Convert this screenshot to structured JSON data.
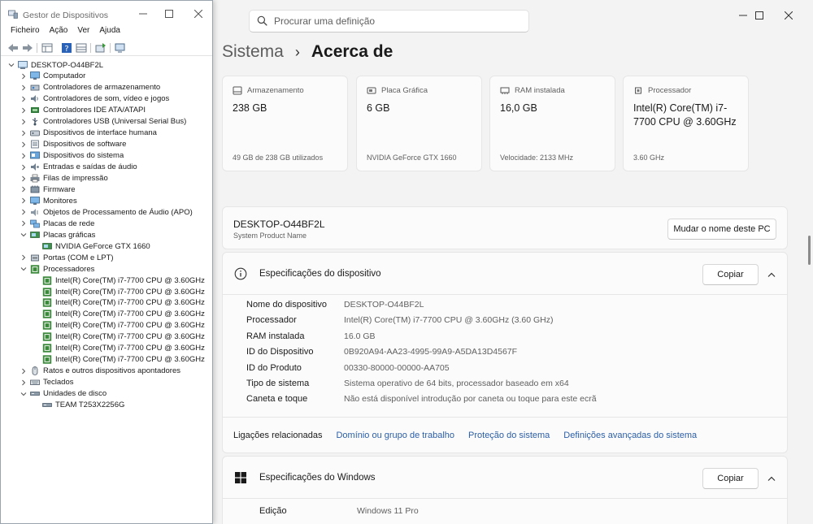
{
  "settings": {
    "search_placeholder": "Procurar uma definição",
    "breadcrumb_parent": "Sistema",
    "breadcrumb_current": "Acerca de",
    "cards": [
      {
        "label": "Armazenamento",
        "value": "238 GB",
        "sub": "49 GB de 238 GB utilizados",
        "icon": "storage-icon"
      },
      {
        "label": "Placa Gráfica",
        "value": "6 GB",
        "sub": "NVIDIA GeForce GTX 1660",
        "icon": "gpu-icon"
      },
      {
        "label": "RAM instalada",
        "value": "16,0 GB",
        "sub": "Velocidade: 2133 MHz",
        "icon": "ram-icon"
      },
      {
        "label": "Processador",
        "value": "Intel(R) Core(TM) i7-7700 CPU @ 3.60GHz",
        "sub": "3.60 GHz",
        "icon": "cpu-icon"
      }
    ],
    "device_name": "DESKTOP-O44BF2L",
    "device_sub": "System Product Name",
    "rename_button": "Mudar o nome deste PC",
    "device_specs_title": "Especificações do dispositivo",
    "copy_button": "Copiar",
    "device_specs": [
      {
        "k": "Nome do dispositivo",
        "v": "DESKTOP-O44BF2L"
      },
      {
        "k": "Processador",
        "v": "Intel(R) Core(TM) i7-7700 CPU @ 3.60GHz (3.60 GHz)"
      },
      {
        "k": "RAM instalada",
        "v": "16.0 GB"
      },
      {
        "k": "ID do Dispositivo",
        "v": "0B920A94-AA23-4995-99A9-A5DA13D4567F"
      },
      {
        "k": "ID do Produto",
        "v": "00330-80000-00000-AA705"
      },
      {
        "k": "Tipo de sistema",
        "v": "Sistema operativo de 64 bits, processador baseado em x64"
      },
      {
        "k": "Caneta e toque",
        "v": "Não está disponível introdução por caneta ou toque para este ecrã"
      }
    ],
    "related_label": "Ligações relacionadas",
    "related_links": [
      "Domínio ou grupo de trabalho",
      "Proteção do sistema",
      "Definições avançadas do sistema"
    ],
    "windows_specs_title": "Especificações do Windows",
    "windows_copy_button": "Copiar",
    "windows_specs": [
      {
        "k": "Edição",
        "v": "Windows 11 Pro"
      }
    ]
  },
  "devmgr": {
    "title": "Gestor de Dispositivos",
    "menu": [
      "Ficheiro",
      "Ação",
      "Ver",
      "Ajuda"
    ],
    "tree": [
      {
        "label": "DESKTOP-O44BF2L",
        "level": 0,
        "exp": "open",
        "icon": "computer-icon"
      },
      {
        "label": "Computador",
        "level": 1,
        "exp": "closed",
        "icon": "monitor-icon"
      },
      {
        "label": "Controladores de armazenamento",
        "level": 1,
        "exp": "closed",
        "icon": "storage-controller-icon"
      },
      {
        "label": "Controladores de som, vídeo e jogos",
        "level": 1,
        "exp": "closed",
        "icon": "sound-icon"
      },
      {
        "label": "Controladores IDE ATA/ATAPI",
        "level": 1,
        "exp": "closed",
        "icon": "ide-icon"
      },
      {
        "label": "Controladores USB (Universal Serial Bus)",
        "level": 1,
        "exp": "closed",
        "icon": "usb-icon"
      },
      {
        "label": "Dispositivos de interface humana",
        "level": 1,
        "exp": "closed",
        "icon": "hid-icon"
      },
      {
        "label": "Dispositivos de software",
        "level": 1,
        "exp": "closed",
        "icon": "software-device-icon"
      },
      {
        "label": "Dispositivos do sistema",
        "level": 1,
        "exp": "closed",
        "icon": "system-device-icon"
      },
      {
        "label": "Entradas e saídas de áudio",
        "level": 1,
        "exp": "closed",
        "icon": "audio-io-icon"
      },
      {
        "label": "Filas de impressão",
        "level": 1,
        "exp": "closed",
        "icon": "printer-icon"
      },
      {
        "label": "Firmware",
        "level": 1,
        "exp": "closed",
        "icon": "firmware-icon"
      },
      {
        "label": "Monitores",
        "level": 1,
        "exp": "closed",
        "icon": "monitor-icon"
      },
      {
        "label": "Objetos de Processamento de Áudio (APO)",
        "level": 1,
        "exp": "closed",
        "icon": "apo-icon"
      },
      {
        "label": "Placas de rede",
        "level": 1,
        "exp": "closed",
        "icon": "network-icon"
      },
      {
        "label": "Placas gráficas",
        "level": 1,
        "exp": "open",
        "icon": "display-adapter-icon"
      },
      {
        "label": "NVIDIA GeForce GTX 1660",
        "level": 2,
        "exp": "none",
        "icon": "display-adapter-icon"
      },
      {
        "label": "Portas (COM e LPT)",
        "level": 1,
        "exp": "closed",
        "icon": "port-icon"
      },
      {
        "label": "Processadores",
        "level": 1,
        "exp": "open",
        "icon": "processor-icon"
      },
      {
        "label": "Intel(R) Core(TM) i7-7700 CPU @ 3.60GHz",
        "level": 2,
        "exp": "none",
        "icon": "processor-icon"
      },
      {
        "label": "Intel(R) Core(TM) i7-7700 CPU @ 3.60GHz",
        "level": 2,
        "exp": "none",
        "icon": "processor-icon"
      },
      {
        "label": "Intel(R) Core(TM) i7-7700 CPU @ 3.60GHz",
        "level": 2,
        "exp": "none",
        "icon": "processor-icon"
      },
      {
        "label": "Intel(R) Core(TM) i7-7700 CPU @ 3.60GHz",
        "level": 2,
        "exp": "none",
        "icon": "processor-icon"
      },
      {
        "label": "Intel(R) Core(TM) i7-7700 CPU @ 3.60GHz",
        "level": 2,
        "exp": "none",
        "icon": "processor-icon"
      },
      {
        "label": "Intel(R) Core(TM) i7-7700 CPU @ 3.60GHz",
        "level": 2,
        "exp": "none",
        "icon": "processor-icon"
      },
      {
        "label": "Intel(R) Core(TM) i7-7700 CPU @ 3.60GHz",
        "level": 2,
        "exp": "none",
        "icon": "processor-icon"
      },
      {
        "label": "Intel(R) Core(TM) i7-7700 CPU @ 3.60GHz",
        "level": 2,
        "exp": "none",
        "icon": "processor-icon"
      },
      {
        "label": "Ratos e outros dispositivos apontadores",
        "level": 1,
        "exp": "closed",
        "icon": "mouse-icon"
      },
      {
        "label": "Teclados",
        "level": 1,
        "exp": "closed",
        "icon": "keyboard-icon"
      },
      {
        "label": "Unidades de disco",
        "level": 1,
        "exp": "open",
        "icon": "disk-icon"
      },
      {
        "label": "TEAM T253X2256G",
        "level": 2,
        "exp": "none",
        "icon": "disk-icon"
      }
    ]
  }
}
